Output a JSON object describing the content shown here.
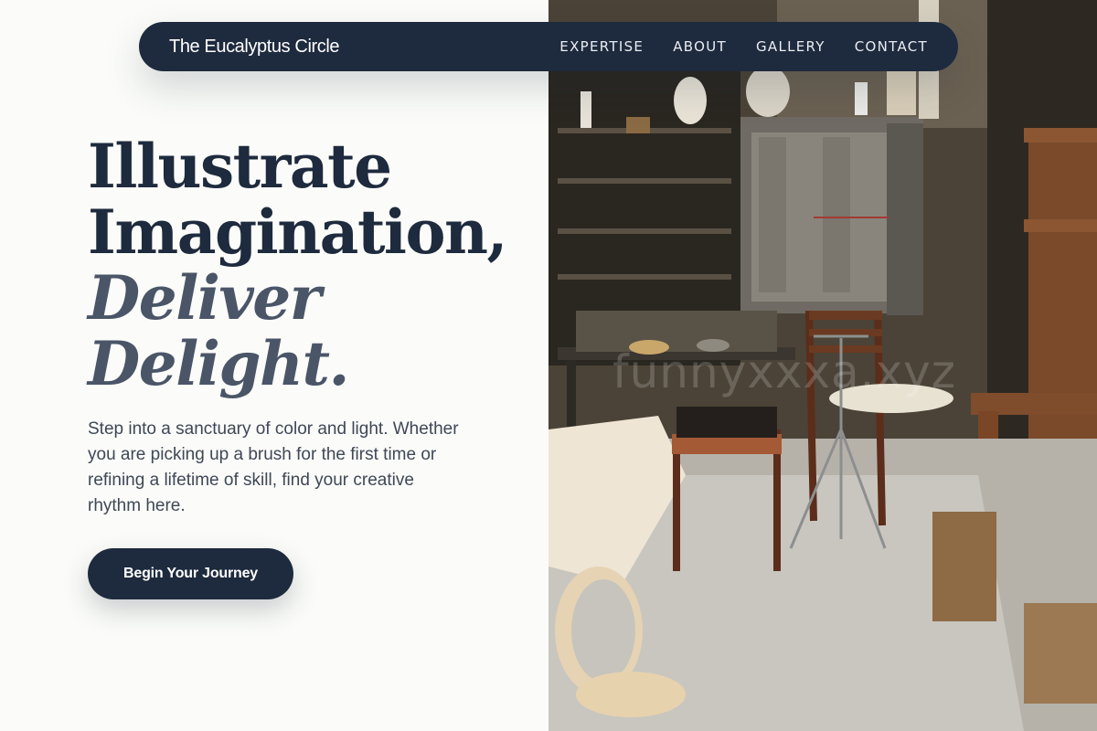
{
  "nav": {
    "brand": "The Eucalyptus Circle",
    "links": [
      "EXPERTISE",
      "ABOUT",
      "GALLERY",
      "CONTACT"
    ]
  },
  "hero": {
    "headline": [
      "Illustrate",
      "Imagination,",
      "Deliver",
      "Delight."
    ],
    "lede": "Step into a sanctuary of color and light. Whether you are picking up a brush for the first time or refining a lifetime of skill, find your creative rhythm here.",
    "cta_label": "Begin Your Journey"
  },
  "photo": {
    "alt": "Artist studio with wooden chairs, shelves of pottery and a kiln",
    "watermark": "funnyxxxa.xyz"
  },
  "colors": {
    "navy": "#1e2a3d",
    "slate": "#4a5568",
    "background": "#fbfcf9"
  }
}
